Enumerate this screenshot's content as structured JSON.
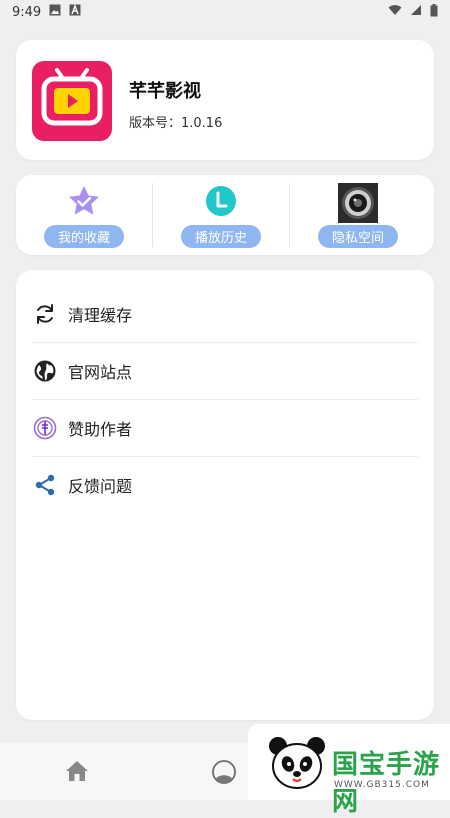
{
  "status_bar": {
    "time": "9:49",
    "icons_left": [
      "image-icon",
      "text-a-icon"
    ],
    "icons_right": [
      "wifi-icon",
      "signal-icon",
      "battery-icon"
    ]
  },
  "app_info": {
    "name": "芊芊影视",
    "version": "版本号：1.0.16",
    "logo_icon": "tv-play-icon",
    "logo_color": "#e91e63"
  },
  "quick_actions": [
    {
      "label": "我的收藏",
      "icon": "star-check-icon"
    },
    {
      "label": "播放历史",
      "icon": "clock-icon"
    },
    {
      "label": "隐私空间",
      "icon": "camera-lens-icon"
    }
  ],
  "menu": [
    {
      "label": "清理缓存",
      "icon": "refresh-icon"
    },
    {
      "label": "官网站点",
      "icon": "globe-icon"
    },
    {
      "label": "赞助作者",
      "icon": "sponsor-icon"
    },
    {
      "label": "反馈问题",
      "icon": "share-icon"
    }
  ],
  "bottom_nav": [
    {
      "name": "home",
      "icon": "home-icon"
    },
    {
      "name": "mine",
      "icon": "profile-icon"
    }
  ],
  "watermark": {
    "text": "国宝手游网",
    "url": "WWW.GB315.COM"
  },
  "colors": {
    "accent_label_bg": "#8fb6f0",
    "background": "#efefef"
  }
}
